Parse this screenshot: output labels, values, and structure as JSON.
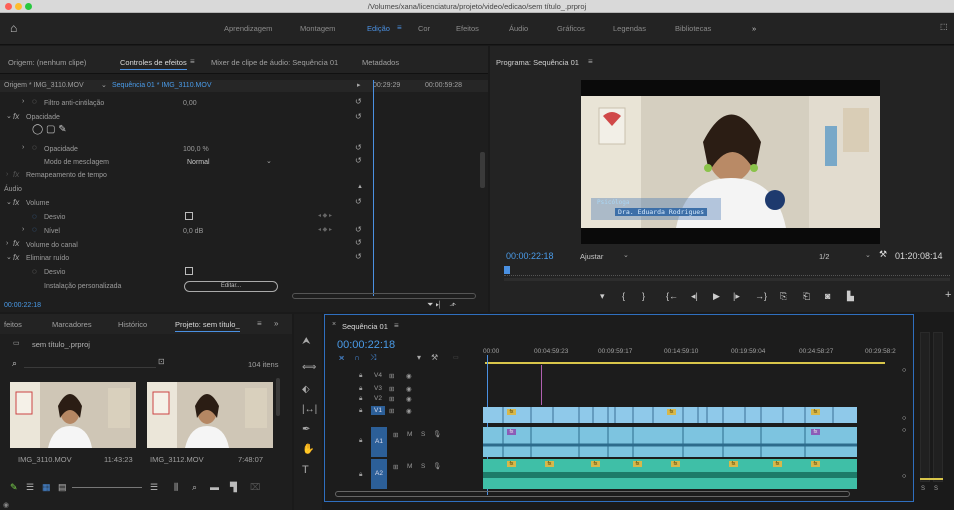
{
  "window": {
    "title": "/Volumes/xana/licenciatura/projeto/video/edicao/sem título_.prproj"
  },
  "workspace": {
    "home_icon": "home-icon",
    "tabs": [
      "Aprendizagem",
      "Montagem",
      "Edição",
      "Cor",
      "Efeitos",
      "Áudio",
      "Gráficos",
      "Legendas",
      "Bibliotecas"
    ],
    "active_tab": "Edição",
    "more": "»"
  },
  "source_panel": {
    "tabs": [
      "Origem: (nenhum clipe)",
      "Controles de efeitos",
      "Mixer de clipe de áudio: Sequência 01",
      "Metadados"
    ],
    "clip_selector": "Origem * IMG_3110.MOV",
    "sequence_link": "Sequência 01 * IMG_3110.MOV",
    "tc_left": "00:29:29",
    "tc_right": "00:00:59:28",
    "rows": [
      {
        "label": "Filtro anti-cintilação",
        "value": "0,00"
      },
      {
        "label": "Opacidade",
        "value": ""
      },
      {
        "label": "Opacidade",
        "value": "100,0 %"
      },
      {
        "label": "Modo de mesclagem",
        "value": "Normal"
      },
      {
        "label": "Remapeamento de tempo",
        "value": ""
      },
      {
        "label": "Áudio",
        "value": ""
      },
      {
        "label": "Volume",
        "value": ""
      },
      {
        "label": "Desvio",
        "value": ""
      },
      {
        "label": "Nível",
        "value": "0,0 dB"
      },
      {
        "label": "Volume do canal",
        "value": ""
      },
      {
        "label": "Eliminar ruído",
        "value": ""
      },
      {
        "label": "Desvio",
        "value": ""
      },
      {
        "label": "Instalação personalizada",
        "value": ""
      }
    ],
    "edit_button": "Editar...",
    "footer_tc": "00:00:22:18"
  },
  "program_panel": {
    "title": "Programa: Sequência 01",
    "tc_current": "00:00:22:18",
    "fit": "Ajustar",
    "resolution": "1/2",
    "tc_duration": "01:20:08:14",
    "lower_third": {
      "line1": "Psicóloga",
      "line2": "Dra. Eduarda Rodrigues"
    }
  },
  "project_panel": {
    "tabs": [
      "feitos",
      "Marcadores",
      "Histórico",
      "Projeto: sem título_"
    ],
    "project_name": "sem título_.prproj",
    "item_count": "104 itens",
    "items": [
      {
        "name": "IMG_3110.MOV",
        "duration": "11:43:23"
      },
      {
        "name": "IMG_3112.MOV",
        "duration": "7:48:07"
      }
    ]
  },
  "timeline": {
    "tab": "Sequência 01",
    "tc": "00:00:22:18",
    "ruler": [
      "00:00",
      "00:04:59:23",
      "00:09:59:17",
      "00:14:59:10",
      "00:19:59:04",
      "00:24:58:27",
      "00:29:58:2"
    ],
    "video_tracks": [
      "V4",
      "V3",
      "V2",
      "V1"
    ],
    "audio_tracks": [
      "A1",
      "A2"
    ],
    "audio_flags": [
      "M",
      "S"
    ]
  },
  "meters": {
    "labels": [
      "S",
      "S"
    ]
  },
  "colors": {
    "accent": "#4a90e2",
    "clip_video": "#8fc9ea",
    "clip_audio1": "#7dc4e0",
    "clip_audio2": "#3fbfa7",
    "fx": "#d8b84a",
    "playhead": "#4a90e2"
  }
}
